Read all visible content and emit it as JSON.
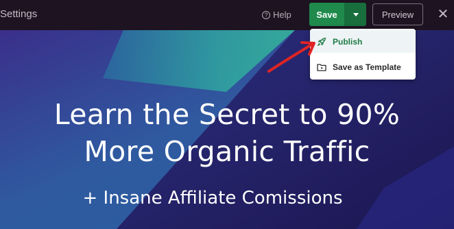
{
  "topbar": {
    "settings_label": "Settings",
    "help_label": "Help",
    "save_label": "Save",
    "preview_label": "Preview",
    "close_glyph": "✕"
  },
  "save_menu": {
    "items": [
      {
        "label": "Publish",
        "icon": "rocket-icon"
      },
      {
        "label": "Save as Template",
        "icon": "folder-icon"
      }
    ]
  },
  "hero": {
    "headline_line1": "Learn the Secret to 90%",
    "headline_line2": "More Organic Traffic",
    "subline": "+ Insane Affiliate Comissions"
  },
  "colors": {
    "save_green": "#1f8a4c",
    "publish_text": "#1f7a44",
    "annotation_arrow": "#e02424",
    "topbar_bg": "#1e1320"
  }
}
